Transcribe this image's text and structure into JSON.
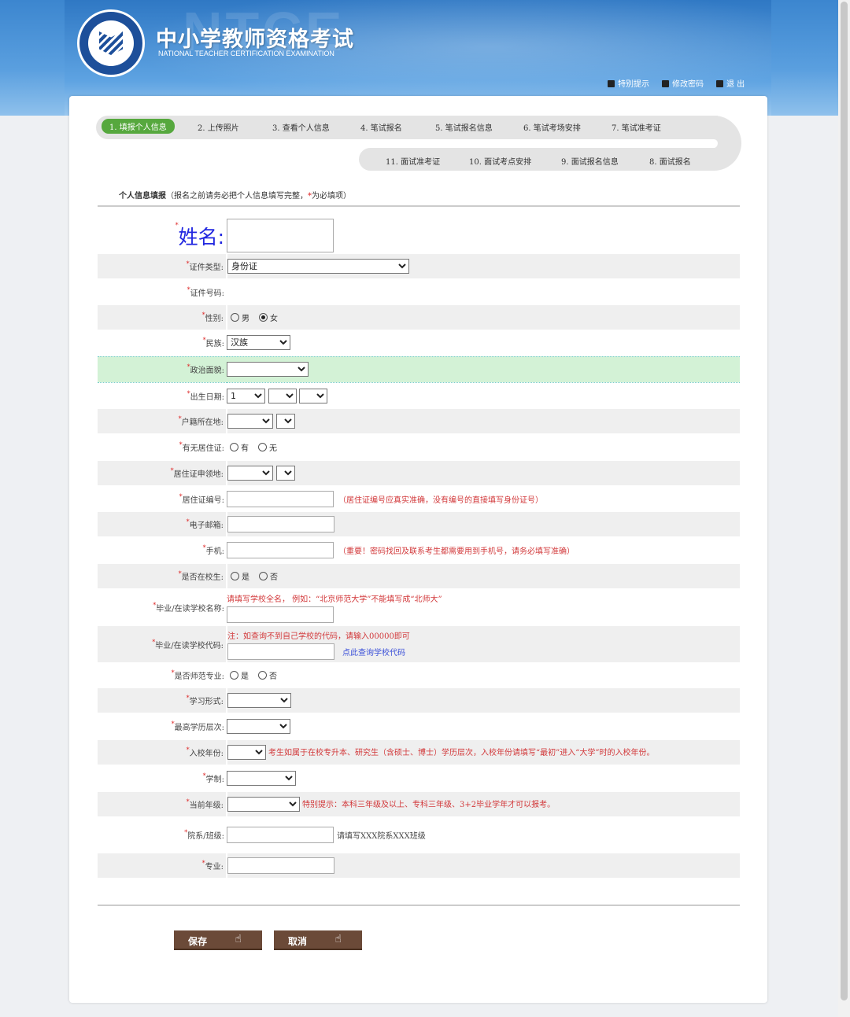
{
  "header": {
    "title": "中小学教师资格考试",
    "subtitle": "NATIONAL TEACHER CERTIFICATION EXAMINATION",
    "watermark": "NTCE",
    "links": [
      {
        "label": "特别提示",
        "icon": "question-icon"
      },
      {
        "label": "修改密码",
        "icon": "key-icon"
      },
      {
        "label": "退 出",
        "icon": "logout-icon"
      }
    ]
  },
  "steps": [
    "1. 填报个人信息",
    "2. 上传照片",
    "3. 查看个人信息",
    "4. 笔试报名",
    "5. 笔试报名信息",
    "6. 笔试考场安排",
    "7. 笔试准考证",
    "8. 面试报名",
    "9. 面试报名信息",
    "10. 面试考点安排",
    "11. 面试准考证"
  ],
  "intro": {
    "title": "个人信息填报",
    "note_a": "（报名之前请务必把个人信息填写完整，",
    "star": "*",
    "note_b": "为必填项）"
  },
  "form": {
    "name_label": "姓名:",
    "id_type": {
      "label": "证件类型:",
      "value": "身份证"
    },
    "id_number": {
      "label": "证件号码:"
    },
    "gender": {
      "label": "性别:",
      "options": [
        "男",
        "女"
      ],
      "selected": "女"
    },
    "ethnicity": {
      "label": "民族:",
      "value": "汉族"
    },
    "political": {
      "label": "政治面貌:",
      "value": ""
    },
    "birth": {
      "label": "出生日期:",
      "value": "1"
    },
    "household": {
      "label": "户籍所在地:"
    },
    "has_permit": {
      "label": "有无居住证:",
      "options": [
        "有",
        "无"
      ]
    },
    "permit_place": {
      "label": "居住证申领地:"
    },
    "permit_no": {
      "label": "居住证编号:",
      "hint": "（居住证编号应真实准确，没有编号的直接填写身份证号）"
    },
    "email": {
      "label": "电子邮箱:"
    },
    "phone": {
      "label": "手机:",
      "hint": "（重要！密码找回及联系考生都需要用到手机号，请务必填写准确）"
    },
    "in_school": {
      "label": "是否在校生:",
      "options": [
        "是",
        "否"
      ]
    },
    "school_name": {
      "label": "毕业/在读学校名称:",
      "hint": "请填写学校全名， 例如：“北京师范大学”不能填写成“北师大”"
    },
    "school_code": {
      "label": "毕业/在读学校代码:",
      "hint": "注：如查询不到自己学校的代码，请输入00000即可",
      "link": "点此查询学校代码"
    },
    "normal_major": {
      "label": "是否师范专业:",
      "options": [
        "是",
        "否"
      ]
    },
    "study_form": {
      "label": "学习形式:"
    },
    "education": {
      "label": "最高学历层次:"
    },
    "entry_year": {
      "label": "入校年份:",
      "hint": "考生如属于在校专升本、研究生（含硕士、博士）学历层次，入校年份请填写“最初”进入“大学”时的入校年份。"
    },
    "schooling": {
      "label": "学制:"
    },
    "grade": {
      "label": "当前年级:",
      "hint": "特别提示：本科三年级及以上、专科三年级、3+2毕业学年才可以报考。"
    },
    "dept": {
      "label": "院系/班级:",
      "note": "请填写XXX院系XXX班级"
    },
    "major": {
      "label": "专业:"
    }
  },
  "buttons": {
    "save": "保存",
    "cancel": "取消"
  },
  "colors": {
    "header_blue": "#3c86cf",
    "step_active": "#56a83e",
    "button": "#6b4a38",
    "hint_red": "#d2383a",
    "highlight_row": "#d3f2d6"
  }
}
